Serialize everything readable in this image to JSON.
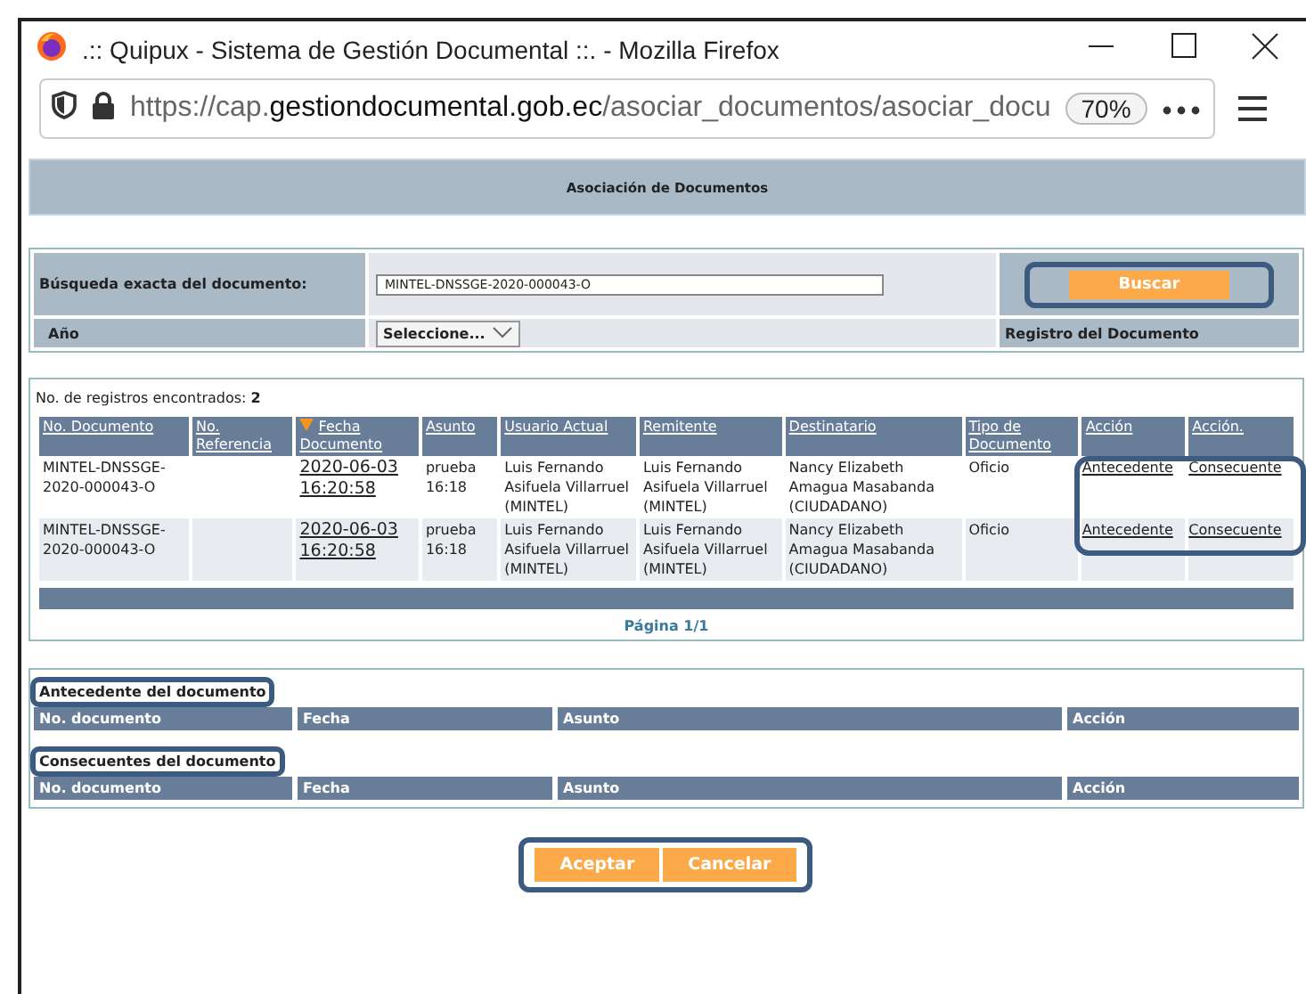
{
  "window": {
    "title": ".:: Quipux - Sistema de Gestión Documental ::. - Mozilla Firefox"
  },
  "address_bar": {
    "scheme": "https://cap.",
    "domain": "gestiondocumental.gob.ec",
    "path": "/asociar_documentos/asociar_docu",
    "zoom": "70%"
  },
  "header": {
    "title": "Asociación de Documentos"
  },
  "search": {
    "label": "Búsqueda exacta del documento:",
    "value": "MINTEL-DNSSGE-2020-000043-O",
    "button": "Buscar",
    "year_label": "Año",
    "year_select": "Seleccione...",
    "register_label": "Registro del Documento"
  },
  "results": {
    "count_label": "No. de registros encontrados:",
    "count": "2",
    "columns": [
      {
        "label": "No. Documento",
        "sorted": false
      },
      {
        "label": "No. Referencia",
        "sorted": false
      },
      {
        "label": "Fecha Documento",
        "sorted": true
      },
      {
        "label": "Asunto",
        "sorted": false
      },
      {
        "label": "Usuario Actual",
        "sorted": false
      },
      {
        "label": "Remitente",
        "sorted": false
      },
      {
        "label": "Destinatario",
        "sorted": false
      },
      {
        "label": "Tipo de Documento",
        "sorted": false
      },
      {
        "label": "Acción",
        "sorted": false
      },
      {
        "label": "Acción.",
        "sorted": false
      }
    ],
    "rows": [
      {
        "cells": [
          {
            "kind": "text",
            "text": "MINTEL-DNSSGE-2020-000043-O"
          },
          {
            "kind": "blank"
          },
          {
            "kind": "date",
            "text": "2020-06-03 16:20:58"
          },
          {
            "kind": "text",
            "text": "prueba 16:18"
          },
          {
            "kind": "text",
            "text": "Luis Fernando Asifuela Villarruel (MINTEL)"
          },
          {
            "kind": "text",
            "text": "Luis Fernando Asifuela Villarruel (MINTEL)"
          },
          {
            "kind": "text",
            "text": "Nancy Elizabeth Amagua Masabanda (CIUDADANO)"
          },
          {
            "kind": "text",
            "text": "Oficio"
          },
          {
            "kind": "link",
            "text": "Antecedente"
          },
          {
            "kind": "link",
            "text": "Consecuente"
          }
        ]
      },
      {
        "cells": [
          {
            "kind": "text",
            "text": "MINTEL-DNSSGE-2020-000043-O"
          },
          {
            "kind": "blank"
          },
          {
            "kind": "date",
            "text": "2020-06-03 16:20:58"
          },
          {
            "kind": "text",
            "text": "prueba 16:18"
          },
          {
            "kind": "text",
            "text": "Luis Fernando Asifuela Villarruel (MINTEL)"
          },
          {
            "kind": "text",
            "text": "Luis Fernando Asifuela Villarruel (MINTEL)"
          },
          {
            "kind": "text",
            "text": "Nancy Elizabeth Amagua Masabanda (CIUDADANO)"
          },
          {
            "kind": "text",
            "text": "Oficio"
          },
          {
            "kind": "link",
            "text": "Antecedente"
          },
          {
            "kind": "link",
            "text": "Consecuente"
          }
        ]
      }
    ],
    "pagination": "Página 1/1"
  },
  "sections": [
    {
      "title": "Antecedente del documento",
      "columns": [
        "No. documento",
        "Fecha",
        "Asunto",
        "Acción"
      ]
    },
    {
      "title": "Consecuentes del documento",
      "columns": [
        "No. documento",
        "Fecha",
        "Asunto",
        "Acción"
      ]
    }
  ],
  "buttons": [
    "Aceptar",
    "Cancelar"
  ]
}
